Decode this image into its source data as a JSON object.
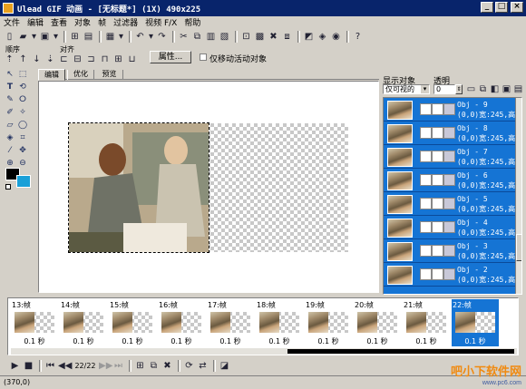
{
  "window": {
    "title": "Ulead GIF 动画 - [无标题*] (1X) 490x225"
  },
  "menu": [
    "文件",
    "编辑",
    "查看",
    "对象",
    "帧",
    "过滤器",
    "视频 F/X",
    "帮助"
  ],
  "props": {
    "order_label": "顺序",
    "align_label": "对齐",
    "attr_button": "属性...",
    "move_only_label": "仅移动活动对象"
  },
  "tabs": [
    "编辑",
    "优化",
    "预览"
  ],
  "right_panel": {
    "display_label": "显示对象",
    "transparency_label": "透明",
    "display_value": "仅可视的",
    "transparency_value": "0"
  },
  "objects": [
    {
      "name": "Obj - 9",
      "info": "(0,0)宽:245,高"
    },
    {
      "name": "Obj - 8",
      "info": "(0,0)宽:245,高"
    },
    {
      "name": "Obj - 7",
      "info": "(0,0)宽:245,高"
    },
    {
      "name": "Obj - 6",
      "info": "(0,0)宽:245,高"
    },
    {
      "name": "Obj - 5",
      "info": "(0,0)宽:245,高"
    },
    {
      "name": "Obj - 4",
      "info": "(0,0)宽:245,高"
    },
    {
      "name": "Obj - 3",
      "info": "(0,0)宽:245,高"
    },
    {
      "name": "Obj - 2",
      "info": "(0,0)宽:245,高"
    }
  ],
  "frames": [
    {
      "label": "13:帧",
      "time": "0.1 秒"
    },
    {
      "label": "14:帧",
      "time": "0.1 秒"
    },
    {
      "label": "15:帧",
      "time": "0.1 秒"
    },
    {
      "label": "16:帧",
      "time": "0.1 秒"
    },
    {
      "label": "17:帧",
      "time": "0.1 秒"
    },
    {
      "label": "18:帧",
      "time": "0.1 秒"
    },
    {
      "label": "19:帧",
      "time": "0.1 秒"
    },
    {
      "label": "20:帧",
      "time": "0.1 秒"
    },
    {
      "label": "21:帧",
      "time": "0.1 秒"
    },
    {
      "label": "22:帧",
      "time": "0.1 秒"
    }
  ],
  "playback": {
    "frame_counter": "22/22"
  },
  "status": {
    "coords": "(370,0)"
  },
  "colors": {
    "accent": "#1574d4",
    "titlebar": "#08246b",
    "face": "#d4d0c8",
    "bg_color": "#1aa0d8",
    "fg_color": "#000000"
  },
  "watermark": {
    "text": "吧小下软件网 www.pc6.com"
  }
}
